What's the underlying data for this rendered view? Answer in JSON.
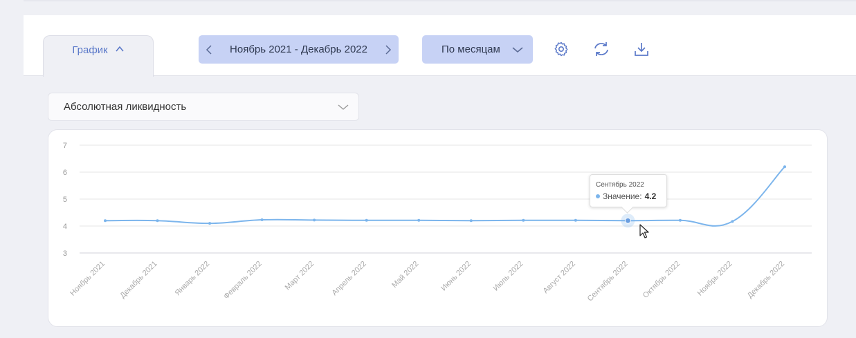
{
  "tab": {
    "label": "График",
    "icon": "chevron-up-icon"
  },
  "period": {
    "label": "Ноябрь 2021 - Декабрь 2022",
    "prev_icon": "chevron-left-icon",
    "next_icon": "chevron-right-icon"
  },
  "grouping": {
    "label": "По месяцам",
    "icon": "chevron-down-icon"
  },
  "toolbar": {
    "settings_icon": "gear-icon",
    "refresh_icon": "refresh-icon",
    "download_icon": "download-icon"
  },
  "metric_select": {
    "value": "Абсолютная ликвидность",
    "icon": "chevron-down-icon"
  },
  "colors": {
    "accent": "#5b79c9",
    "button_bg": "#c7d2f5",
    "line": "#7cb5ec"
  },
  "tooltip": {
    "title": "Сентябрь 2022",
    "label": "Значение:",
    "value": "4.2"
  },
  "chart_data": {
    "type": "line",
    "categories": [
      "Ноябрь 2021",
      "Декабрь 2021",
      "Январь 2022",
      "Февраль 2022",
      "Март 2022",
      "Апрель 2022",
      "Май 2022",
      "Июнь 2022",
      "Июль 2022",
      "Август 2022",
      "Сентябрь 2022",
      "Октябрь 2022",
      "Ноябрь 2022",
      "Декабрь 2022"
    ],
    "series": [
      {
        "values": [
          4.2,
          4.2,
          4.1,
          4.23,
          4.22,
          4.21,
          4.21,
          4.2,
          4.21,
          4.21,
          4.2,
          4.21,
          4.17,
          6.2
        ]
      }
    ],
    "ylim": [
      3,
      7
    ],
    "yticks": [
      "3",
      "4",
      "5",
      "6",
      "7"
    ],
    "grid": true,
    "highlighted_index": 10
  }
}
